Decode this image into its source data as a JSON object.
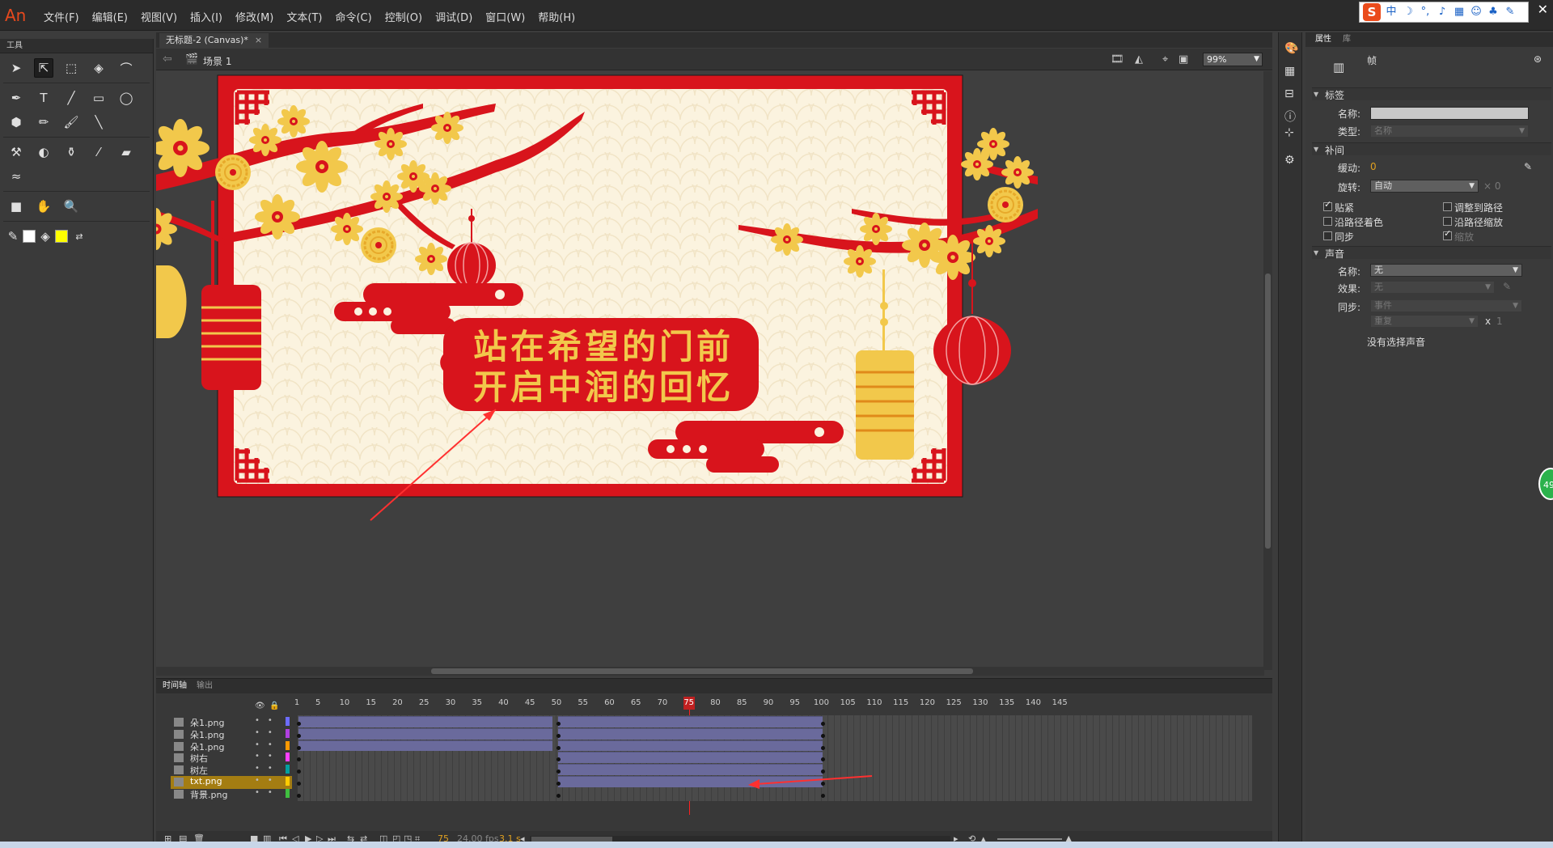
{
  "app": {
    "logo": "An"
  },
  "menu": [
    "文件(F)",
    "编辑(E)",
    "视图(V)",
    "插入(I)",
    "修改(M)",
    "文本(T)",
    "命令(C)",
    "控制(O)",
    "调试(D)",
    "窗口(W)",
    "帮助(H)"
  ],
  "ime": {
    "logo": "S",
    "mode": "中"
  },
  "tools_panel": {
    "title": "工具"
  },
  "document": {
    "tab_title": "无标题-2 (Canvas)*",
    "scene": "场景 1",
    "zoom": "99%"
  },
  "stage": {
    "line1": "站在希望的门前",
    "line2": "开启中润的回忆",
    "colors": {
      "frame": "#d8141c",
      "bg": "#fbf3df",
      "gold": "#f2c84b"
    }
  },
  "timeline": {
    "tabs": [
      "时间轴",
      "输出"
    ],
    "ruler": [
      "1",
      "5",
      "10",
      "15",
      "20",
      "25",
      "30",
      "35",
      "40",
      "45",
      "50",
      "55",
      "60",
      "65",
      "70",
      "75",
      "80",
      "85",
      "90",
      "95",
      "100",
      "105",
      "110",
      "115",
      "120",
      "125",
      "130",
      "135",
      "140",
      "145"
    ],
    "playhead": "75",
    "layers": [
      {
        "name": "朵1.png",
        "color": "#6c6cff"
      },
      {
        "name": "朵1.png",
        "color": "#b040e0"
      },
      {
        "name": "朵1.png",
        "color": "#ff9900"
      },
      {
        "name": "树右",
        "color": "#ff40ff"
      },
      {
        "name": "树左",
        "color": "#00a0a0"
      },
      {
        "name": "txt.png",
        "color": "#ffcc00"
      },
      {
        "name": "背景.png",
        "color": "#40c040"
      }
    ],
    "current_frame": "75",
    "fps": "24.00 fps",
    "time": "3.1 s"
  },
  "properties": {
    "tabs": [
      "属性",
      "库"
    ],
    "frame_label": "帧",
    "label_section": "标签",
    "name_label": "名称:",
    "type_label": "类型:",
    "type_value": "名称",
    "tween_section": "补间",
    "ease_label": "缓动:",
    "ease_value": "0",
    "rotate_label": "旋转:",
    "rotate_value": "自动",
    "rotate_x": "× 0",
    "checks": [
      "贴紧",
      "调整到路径",
      "沿路径着色",
      "沿路径缩放",
      "同步",
      "缩放"
    ],
    "sound_section": "声音",
    "sound_name_label": "名称:",
    "sound_name_value": "无",
    "effect_label": "效果:",
    "effect_value": "无",
    "sync_label": "同步:",
    "sync_value": "事件",
    "repeat_value": "重复",
    "repeat_x": "x",
    "repeat_count": "1",
    "no_sound": "没有选择声音"
  },
  "badge": "49"
}
